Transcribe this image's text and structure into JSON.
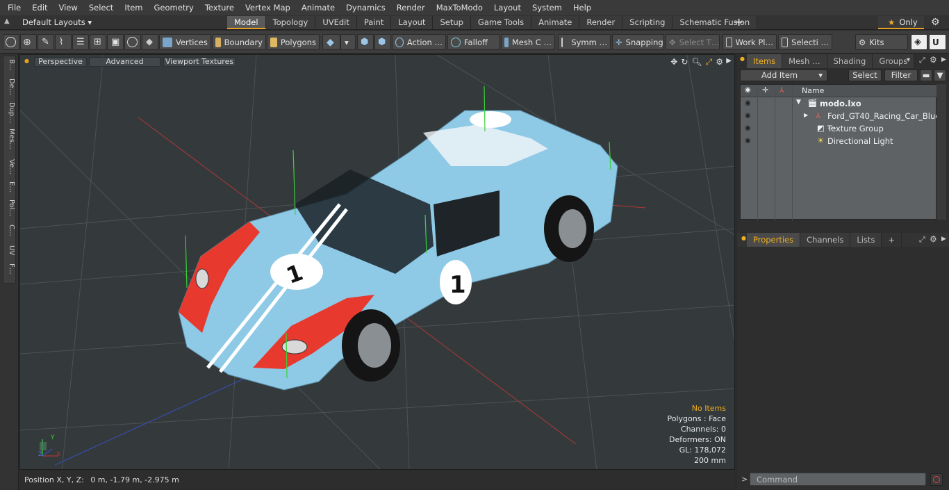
{
  "menubar": [
    "File",
    "Edit",
    "View",
    "Select",
    "Item",
    "Geometry",
    "Texture",
    "Vertex Map",
    "Animate",
    "Dynamics",
    "Render",
    "MaxToModo",
    "Layout",
    "System",
    "Help"
  ],
  "layout": {
    "dropdown": "Default Layouts",
    "tabs": [
      "Model",
      "Topology",
      "UVEdit",
      "Paint",
      "Layout",
      "Setup",
      "Game Tools",
      "Animate",
      "Render",
      "Scripting",
      "Schematic Fusion"
    ],
    "active_tab": "Model",
    "only_label": "Only"
  },
  "toolbar": {
    "vertices": "Vertices",
    "boundary": "Boundary",
    "polygons": "Polygons",
    "action": "Action …",
    "falloff": "Falloff",
    "mesh": "Mesh C …",
    "symm": "Symm …",
    "snapping": "Snapping",
    "select_t": "Select T…",
    "work_pl": "Work Pl…",
    "selecti": "Selecti …",
    "kits": "Kits"
  },
  "leftbar": [
    "B…",
    "De…",
    "Dup…",
    "Mes…",
    "Ve…",
    "E…",
    "Pol…",
    "C…",
    "UV",
    "F…"
  ],
  "viewport": {
    "perspective": "Perspective",
    "advanced": "Advanced",
    "viewport_textures": "Viewport Textures",
    "stats": {
      "items": "No Items",
      "polygons": "Polygons : Face",
      "channels": "Channels: 0",
      "deformers": "Deformers: ON",
      "gl": "GL: 178,072",
      "scale": "200 mm"
    },
    "axis_x": "X",
    "axis_y": "Y",
    "axis_z": "Z",
    "body_color": "#8ec9e6",
    "stripe_color": "#e8392e"
  },
  "statusbar": {
    "position_label": "Position X, Y, Z:",
    "position_value": "0 m, -1.79 m, -2.975 m"
  },
  "rightpanel": {
    "tabs": [
      "Items",
      "Mesh …",
      "Shading",
      "Groups"
    ],
    "add_item": "Add Item",
    "select": "Select",
    "filter": "Filter",
    "name_header": "Name",
    "items": [
      {
        "name": "modo.lxo",
        "bold": true
      },
      {
        "name": "Ford_GT40_Racing_Car_Blue …"
      },
      {
        "name": "Texture Group"
      },
      {
        "name": "Directional Light"
      }
    ],
    "bottom_tabs": [
      "Properties",
      "Channels",
      "Lists"
    ],
    "command_placeholder": "Command"
  }
}
